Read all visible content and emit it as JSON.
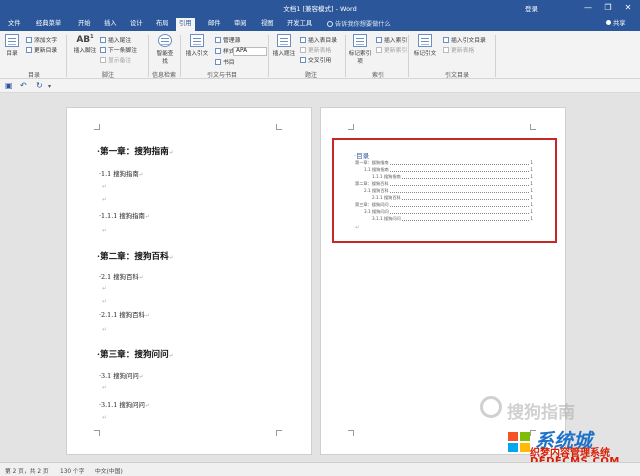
{
  "window": {
    "title": "文档1 [兼容模式] - Word",
    "login": "登录",
    "minimize": "—",
    "restore": "❐",
    "close": "✕"
  },
  "tabs": [
    "文件",
    "经典菜单",
    "开始",
    "插入",
    "设计",
    "布局",
    "引用",
    "邮件",
    "审阅",
    "视图",
    "开发工具"
  ],
  "tell_me": "告诉我你想要做什么",
  "share": "共享",
  "ribbon": {
    "toc_group": {
      "toc": "目录",
      "add_text": "添加文字",
      "update_toc": "更新目录",
      "label": "目录"
    },
    "footnote_group": {
      "insert_footnote": "插入脚注",
      "insert_endnote": "插入尾注",
      "next_footnote": "下一条脚注",
      "show_notes": "显示备注",
      "label": "脚注"
    },
    "research_group": {
      "smart_lookup": "智能查找",
      "label": "信息检索"
    },
    "citation_group": {
      "insert_citation": "插入引文",
      "manage_sources": "管理源",
      "style_label": "样式:",
      "style_value": "APA",
      "bibliography": "书目",
      "label": "引文与书目"
    },
    "caption_group": {
      "insert_caption": "插入题注",
      "insert_table_of_figures": "插入表目录",
      "update_table": "更新表格",
      "cross_reference": "交叉引用",
      "label": "题注"
    },
    "index_group": {
      "mark_entry": "标记索引项",
      "insert_index": "插入索引",
      "update_index": "更新索引",
      "label": "索引"
    },
    "authorities_group": {
      "mark_citation": "标记引文",
      "insert_toa": "插入引文目录",
      "update_toa": "更新表格",
      "label": "引文目录"
    }
  },
  "page1": {
    "headings": [
      {
        "kind": "h1",
        "text": "·第一章：搜狗指南"
      },
      {
        "kind": "h2",
        "text": "·1.1 搜狗指南"
      },
      {
        "kind": "h2",
        "text": "·1.1.1 搜狗指南"
      },
      {
        "kind": "h1",
        "text": "·第二章：搜狗百科"
      },
      {
        "kind": "h2",
        "text": "·2.1 搜狗百科"
      },
      {
        "kind": "h2",
        "text": "·2.1.1 搜狗百科"
      },
      {
        "kind": "h1",
        "text": "·第三章：搜狗问问"
      },
      {
        "kind": "h2",
        "text": "·3.1 搜狗问问"
      },
      {
        "kind": "h2",
        "text": "·3.1.1 搜狗问问"
      }
    ]
  },
  "page2": {
    "toc_title": "·目录",
    "toc_entries": [
      {
        "text": "第一章：搜狗指南",
        "page": "1",
        "level": 1
      },
      {
        "text": "1.1 搜狗指南",
        "page": "1",
        "level": 2
      },
      {
        "text": "1.1.1 搜狗指南",
        "page": "1",
        "level": 3
      },
      {
        "text": "第二章：搜狗百科",
        "page": "1",
        "level": 1
      },
      {
        "text": "2.1 搜狗百科",
        "page": "1",
        "level": 2
      },
      {
        "text": "2.1.1 搜狗百科",
        "page": "1",
        "level": 3
      },
      {
        "text": "第三章：搜狗问问",
        "page": "1",
        "level": 1
      },
      {
        "text": "3.1 搜狗问问",
        "page": "1",
        "level": 2
      },
      {
        "text": "3.1.1 搜狗问问",
        "page": "1",
        "level": 3
      }
    ]
  },
  "watermarks": {
    "sogou": "搜狗指南",
    "dedecms_cn": "织梦内容管理系统",
    "dedecms_url": "DEDECMS.COM",
    "xitong": "系统城"
  },
  "status": {
    "page": "第 2 页，共 2 页",
    "words": "130 个字",
    "lang": "中文(中国)"
  },
  "colors": {
    "brand": "#2b579a",
    "highlight_box": "#c62828"
  }
}
